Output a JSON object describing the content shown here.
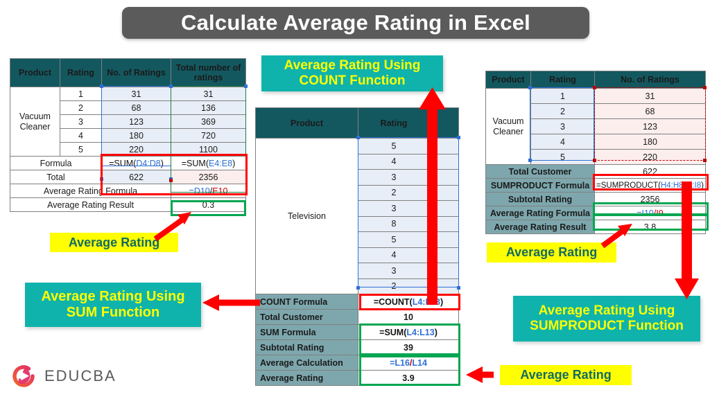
{
  "title": "Calculate Average Rating in Excel",
  "brand": {
    "name": "EDUCBA",
    "logo_icon": "educba-play-circle-icon"
  },
  "colors": {
    "title_bg": "#5b5b5b",
    "table_header": "#13585f",
    "label_band": "#7da7ad",
    "callout_teal": "#0fb3ac",
    "callout_text": "#ffff00",
    "highlight_yellow": "#ffff00",
    "highlight_yellow_text": "#136b62",
    "box_red": "#ff0000",
    "box_green": "#00a651",
    "cell_blue": "#e8eef7",
    "cell_pink": "#fdeeee",
    "formula_blue": "#2e6fd4",
    "formula_red": "#c00000"
  },
  "sum_table": {
    "headers": [
      "Product",
      "Rating",
      "No. of Ratings",
      "Total number of ratings"
    ],
    "product": "Vacuum Cleaner",
    "rows": [
      {
        "rating": "1",
        "no_of_ratings": "31",
        "total": "31"
      },
      {
        "rating": "2",
        "no_of_ratings": "68",
        "total": "136"
      },
      {
        "rating": "3",
        "no_of_ratings": "123",
        "total": "369"
      },
      {
        "rating": "4",
        "no_of_ratings": "180",
        "total": "720"
      },
      {
        "rating": "5",
        "no_of_ratings": "220",
        "total": "1100"
      }
    ],
    "formula_label": "Formula",
    "formula_d": {
      "prefix": "=SUM(",
      "range": "D4:D8",
      "suffix": ")"
    },
    "formula_e": {
      "prefix": "=SUM(",
      "range": "E4:E8",
      "suffix": ")"
    },
    "total_label": "Total",
    "total_d": "622",
    "total_e": "2356",
    "avg_formula_label": "Average Rating Formula",
    "avg_formula": {
      "num": "=D10",
      "slash": "/",
      "den": "E10"
    },
    "avg_result_label": "Average Rating Result",
    "avg_result": "0.3"
  },
  "count_table": {
    "headers": [
      "Product",
      "Rating"
    ],
    "product": "Television",
    "ratings": [
      "5",
      "4",
      "3",
      "2",
      "3",
      "8",
      "5",
      "4",
      "3",
      "2"
    ],
    "rows": [
      {
        "label": "COUNT Formula",
        "value_prefix": "=COUNT(",
        "value_range": "L4:L13",
        "value_suffix": ")"
      },
      {
        "label": "Total Customer",
        "value": "10"
      },
      {
        "label": "SUM Formula",
        "value_prefix": "=SUM(",
        "value_range": "L4:L13",
        "value_suffix": ")"
      },
      {
        "label": "Subtotal Rating",
        "value": "39"
      },
      {
        "label": "Average Calculation",
        "value_num": "=L16",
        "value_slash": "/",
        "value_den": "L14"
      },
      {
        "label": "Average Rating",
        "value": "3.9"
      }
    ]
  },
  "sumproduct_table": {
    "headers": [
      "Product",
      "Rating",
      "No. of Ratings"
    ],
    "product": "Vacuum Cleaner",
    "rows": [
      {
        "rating": "1",
        "no_of_ratings": "31"
      },
      {
        "rating": "2",
        "no_of_ratings": "68"
      },
      {
        "rating": "3",
        "no_of_ratings": "123"
      },
      {
        "rating": "4",
        "no_of_ratings": "180"
      },
      {
        "rating": "5",
        "no_of_ratings": "220"
      }
    ],
    "total_customer_label": "Total Customer",
    "total_customer": "622",
    "sumproduct_label": "SUMPRODUCT Formula",
    "sumproduct_formula": {
      "prefix": "=SUMPRODUCT(",
      "r1": "H4:H8,",
      "r2": "I4:I8",
      "suffix": ")"
    },
    "subtotal_label": "Subtotal Rating",
    "subtotal": "2356",
    "avg_formula_label": "Average Rating Formula",
    "avg_formula": {
      "num": "=I10",
      "slash": "/",
      "den": "I9"
    },
    "avg_result_label": "Average Rating Result",
    "avg_result": "3.8"
  },
  "callouts": {
    "count": "Average Rating Using\nCOUNT Function",
    "count_line1": "Average Rating Using",
    "count_line2": "COUNT Function",
    "sum_line1": "Average Rating Using",
    "sum_line2": "SUM Function",
    "sumproduct_line1": "Average Rating Using",
    "sumproduct_line2": "SUMPRODUCT Function"
  },
  "annotations": {
    "avg_rating_left": "Average Rating",
    "avg_rating_right": "Average Rating",
    "avg_rating_bottom": "Average Rating"
  }
}
